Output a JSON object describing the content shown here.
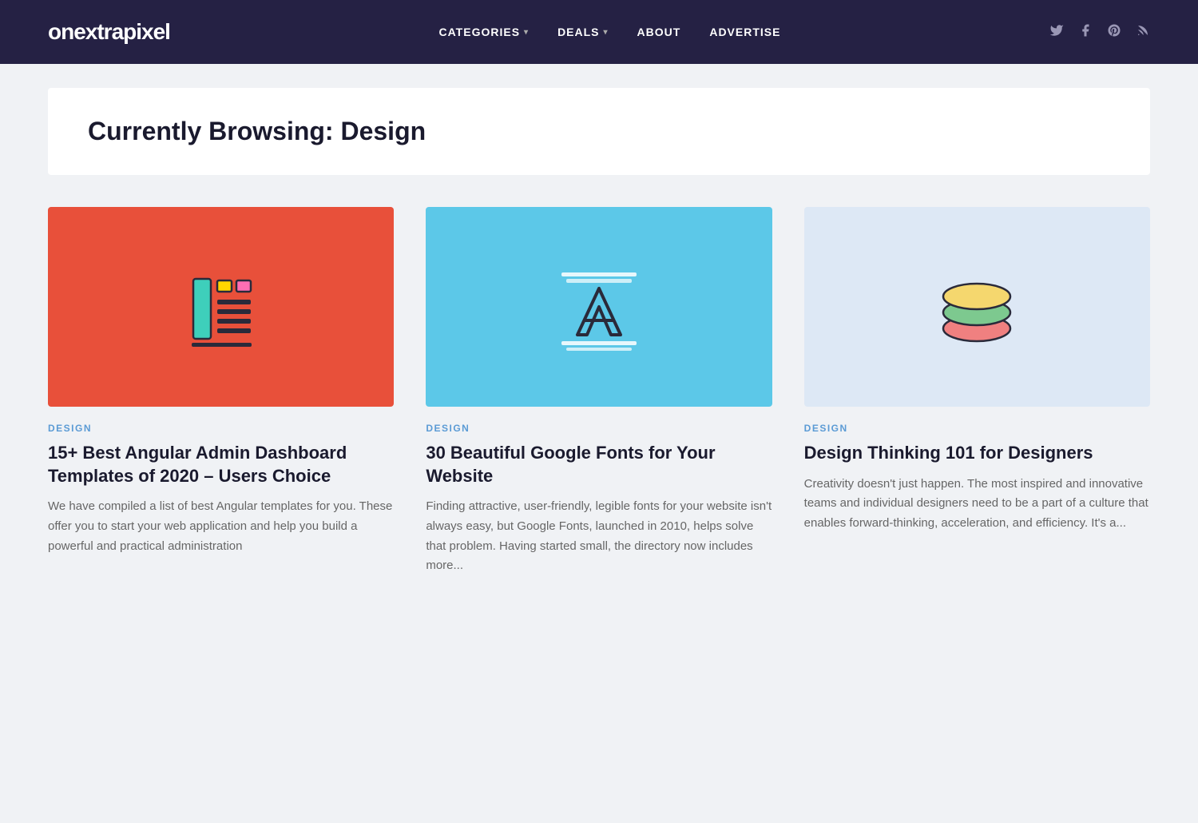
{
  "header": {
    "logo": "onextrapixel",
    "nav": [
      {
        "label": "CATEGORIES",
        "hasDropdown": true
      },
      {
        "label": "DEALS",
        "hasDropdown": true
      },
      {
        "label": "ABOUT",
        "hasDropdown": false
      },
      {
        "label": "ADVERTISE",
        "hasDropdown": false
      }
    ],
    "social": [
      {
        "name": "twitter-icon",
        "symbol": "𝕏"
      },
      {
        "name": "facebook-icon",
        "symbol": "f"
      },
      {
        "name": "pinterest-icon",
        "symbol": "P"
      },
      {
        "name": "rss-icon",
        "symbol": "⌁"
      }
    ]
  },
  "hero": {
    "prefix": "Currently Browsing:",
    "category": "Design",
    "title": "Currently Browsing: Design"
  },
  "cards": [
    {
      "id": 1,
      "category": "DESIGN",
      "title": "15+ Best Angular Admin Dashboard Templates of 2020 – Users Choice",
      "excerpt": "We have compiled a list of best Angular templates for you. These offer you to start your web application and help you build a powerful and practical administration",
      "imageTheme": "red-bg",
      "imageType": "dashboard"
    },
    {
      "id": 2,
      "category": "DESIGN",
      "title": "30 Beautiful Google Fonts for Your Website",
      "excerpt": "Finding attractive, user-friendly, legible fonts for your website isn't always easy, but Google Fonts, launched in 2010, helps solve that problem. Having started small, the directory now includes more...",
      "imageTheme": "blue-bg",
      "imageType": "font"
    },
    {
      "id": 3,
      "category": "DESIGN",
      "title": "Design Thinking 101 for Designers",
      "excerpt": "Creativity doesn't just happen. The most inspired and innovative teams and individual designers need to be a part of a culture that enables forward-thinking, acceleration, and efficiency. It's a...",
      "imageTheme": "lightblue-bg",
      "imageType": "layers"
    }
  ]
}
